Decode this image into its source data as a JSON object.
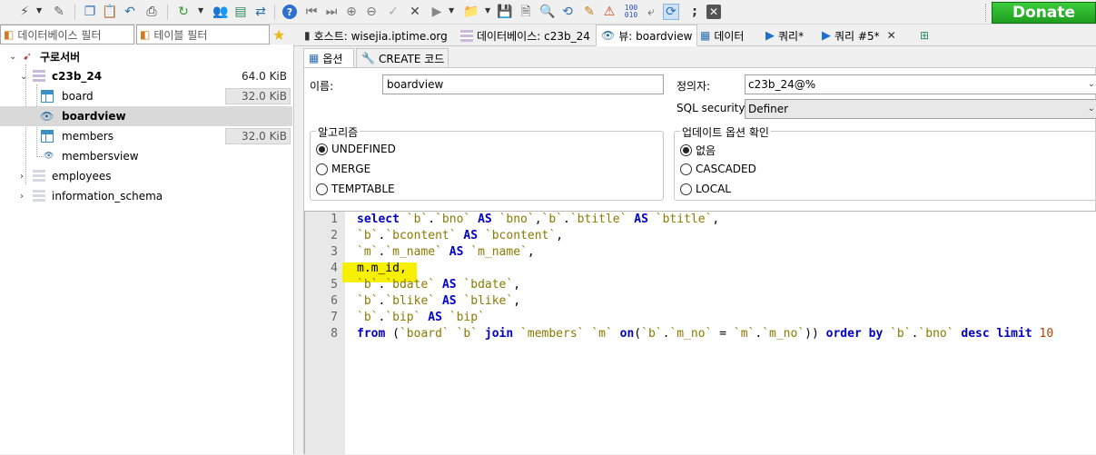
{
  "app": {
    "donate_label": "Donate"
  },
  "filters": {
    "database_filter": "데이터베이스 필터",
    "table_filter": "테이블 필터"
  },
  "tree": {
    "root": {
      "label": "구로서버"
    },
    "database": {
      "label": "c23b_24",
      "size": "64.0 KiB"
    },
    "items": [
      {
        "label": "board",
        "size": "32.0 KiB",
        "type": "table"
      },
      {
        "label": "boardview",
        "size": "",
        "type": "view"
      },
      {
        "label": "members",
        "size": "32.0 KiB",
        "type": "table"
      },
      {
        "label": "membersview",
        "size": "",
        "type": "view"
      }
    ],
    "other_dbs": [
      {
        "label": "employees"
      },
      {
        "label": "information_schema"
      }
    ]
  },
  "tabs": [
    {
      "label": "호스트: wisejia.iptime.org"
    },
    {
      "label": "데이터베이스: c23b_24"
    },
    {
      "label": "뷰: boardview"
    },
    {
      "label": "데이터"
    },
    {
      "label": "쿼리*"
    },
    {
      "label": "쿼리 #5*"
    }
  ],
  "subtabs": [
    {
      "label": "옵션"
    },
    {
      "label": "CREATE 코드"
    }
  ],
  "form": {
    "name_label": "이름:",
    "name_value": "boardview",
    "definer_label": "정의자:",
    "definer_value": "c23b_24@%",
    "security_label": "SQL security:",
    "security_value": "Definer",
    "algorithm_title": "알고리즘",
    "algorithm_options": [
      "UNDEFINED",
      "MERGE",
      "TEMPTABLE"
    ],
    "check_title": "업데이트 옵션 확인",
    "check_options": [
      "없음",
      "CASCADED",
      "LOCAL"
    ]
  },
  "editor": {
    "line_numbers": [
      "1",
      "2",
      "3",
      "4",
      "5",
      "6",
      "7",
      "8"
    ],
    "lines": [
      "select `b`.`bno` AS `bno`,`b`.`btitle` AS `btitle`,",
      "`b`.`bcontent` AS `bcontent`,",
      "`m`.`m_name` AS `m_name`,",
      "m.m_id,",
      "`b`.`bdate` AS `bdate`,",
      "`b`.`blike` AS `blike`,",
      "`b`.`bip` AS `bip`",
      "from (`board` `b` join `members` `m` on(`b`.`m_no` = `m`.`m_no`)) order by `b`.`bno` desc limit 10"
    ]
  },
  "colors": {
    "accent": "#1e6fd0",
    "highlight": "#f7f000",
    "keyword": "#0000c8",
    "donate": "#2bb52b"
  }
}
